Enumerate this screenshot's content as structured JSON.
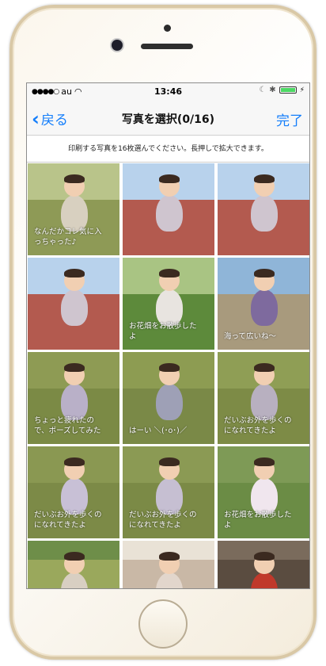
{
  "status_bar": {
    "carrier": "au",
    "time": "13:46"
  },
  "nav": {
    "back_label": "戻る",
    "title": "写真を選択(0/16)",
    "done_label": "完了"
  },
  "instruction": "印刷する写真を16枚選んでください。長押しで拡大できます。",
  "photos": [
    {
      "caption": "なんだかコレ気に入\nっちゃった♪"
    },
    {
      "caption": ""
    },
    {
      "caption": ""
    },
    {
      "caption": ""
    },
    {
      "caption": "お花畑をお散歩した\nよ"
    },
    {
      "caption": "海って広いね〜"
    },
    {
      "caption": "ちょっと疲れたの\nで、ポーズしてみた"
    },
    {
      "caption": "はーい ＼(･o･)／"
    },
    {
      "caption": "だいぶお外を歩くの\nになれてきたよ"
    },
    {
      "caption": "だいぶお外を歩くの\nになれてきたよ"
    },
    {
      "caption": "だいぶお外を歩くの\nになれてきたよ"
    },
    {
      "caption": "お花畑をお散歩した\nよ"
    },
    {
      "caption": ""
    },
    {
      "caption": ""
    },
    {
      "caption": ""
    }
  ],
  "colors": {
    "accent": "#147efb",
    "battery": "#4cd964"
  }
}
